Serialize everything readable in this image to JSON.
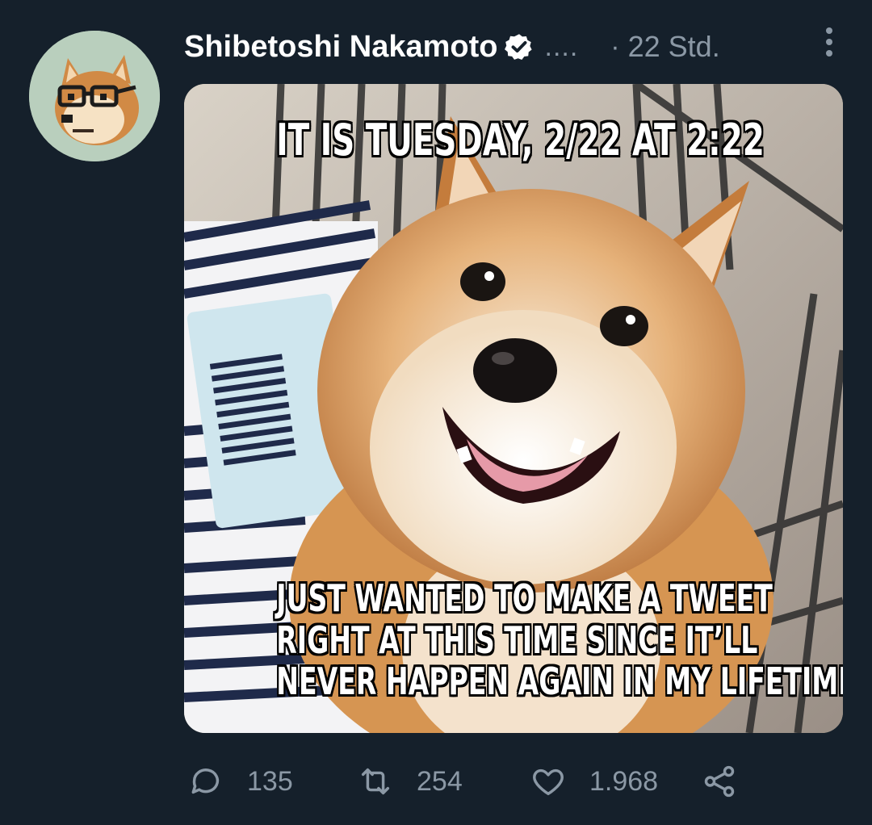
{
  "tweet": {
    "author_name": "Shibetoshi Nakamoto",
    "handle_truncated": "....",
    "separator": "·",
    "timestamp": "22 Std.",
    "verified": true
  },
  "media": {
    "top_text": "IT IS TUESDAY, 2/22 AT 2:22",
    "bottom_lines": [
      "JUST WANTED TO MAKE A TWEET",
      "RIGHT AT THIS TIME SINCE IT’LL",
      "NEVER HAPPEN AGAIN IN MY LIFETIME"
    ]
  },
  "actions": {
    "reply_count": "135",
    "retweet_count": "254",
    "like_count": "1.968",
    "icons": [
      "reply-icon",
      "retweet-icon",
      "like-icon",
      "share-icon"
    ]
  },
  "colors": {
    "background": "#15202b",
    "secondary_text": "#8b98a5",
    "verified_badge": "#ffffff"
  }
}
